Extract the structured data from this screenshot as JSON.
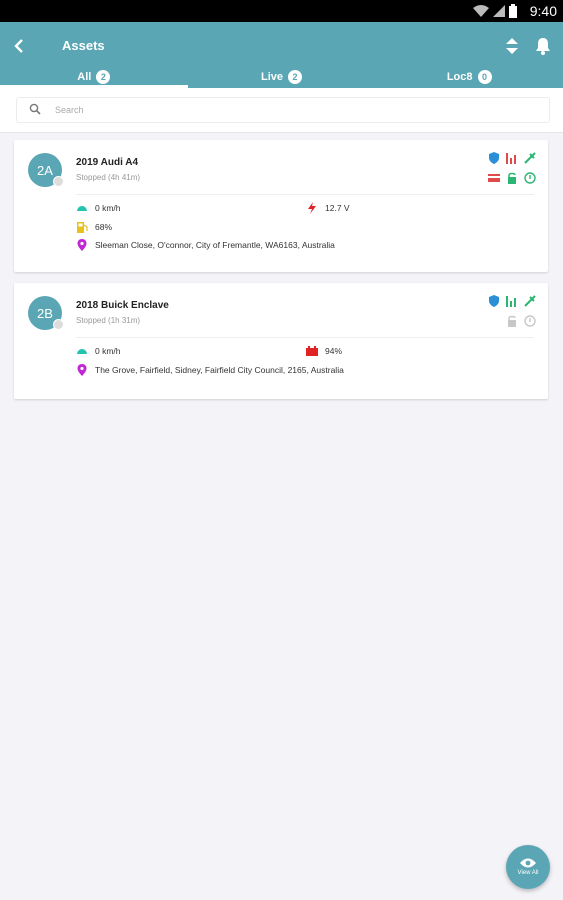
{
  "statusbar": {
    "time": "9:40"
  },
  "header": {
    "title": "Assets"
  },
  "tabs": [
    {
      "label": "All",
      "count": "2",
      "active": true
    },
    {
      "label": "Live",
      "count": "2",
      "active": false
    },
    {
      "label": "Loc8",
      "count": "0",
      "active": false
    }
  ],
  "search": {
    "placeholder": "Search",
    "value": ""
  },
  "assets": [
    {
      "initials": "2A",
      "name": "2019 Audi A4",
      "status": "Stopped (4h 41m)",
      "speed": "0 km/h",
      "voltage": "12.7 V",
      "fuel": "68%",
      "address": "Sleeman Close, O'connor, City of Fremantle, WA6163, Australia",
      "icon_colors": {
        "shield": "#2a8fd6",
        "signal": "#e04a4a",
        "gps": "#2bb673",
        "card": "#e04a4a",
        "lock": "#2bb673",
        "power": "#2bb673"
      }
    },
    {
      "initials": "2B",
      "name": "2018 Buick Enclave",
      "status": "Stopped (1h 31m)",
      "speed": "0 km/h",
      "battery": "94%",
      "address": "The Grove, Fairfield, Sidney, Fairfield City Council, 2165, Australia",
      "icon_colors": {
        "shield": "#2a8fd6",
        "signal": "#2bb673",
        "gps": "#2bb673",
        "lock": "#c8c8c8",
        "power": "#c8c8c8"
      }
    }
  ],
  "fab": {
    "label": "View All"
  },
  "colors": {
    "accent": "#5aa6b4",
    "speed": "#23c3b0",
    "fuel": "#e8c21a",
    "location": "#c026d3",
    "voltage": "#e02424",
    "battery": "#e02424"
  }
}
